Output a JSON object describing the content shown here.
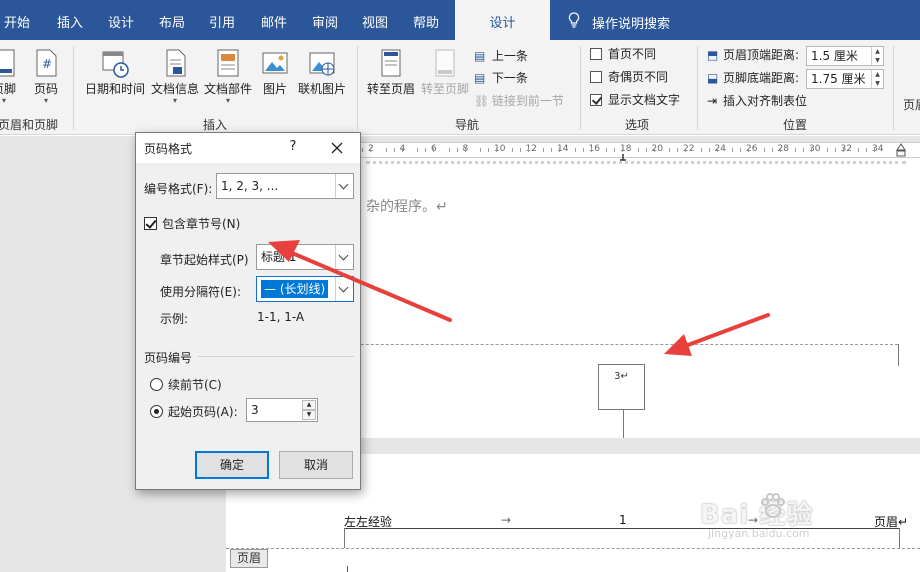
{
  "menu": {
    "tabs": [
      {
        "label": "开始"
      },
      {
        "label": "插入"
      },
      {
        "label": "设计"
      },
      {
        "label": "布局"
      },
      {
        "label": "引用"
      },
      {
        "label": "邮件"
      },
      {
        "label": "审阅"
      },
      {
        "label": "视图"
      },
      {
        "label": "帮助"
      },
      {
        "label": "设计"
      }
    ],
    "tell_me": "操作说明搜索"
  },
  "ribbon": {
    "header_footer_group": {
      "footer_label": "页脚",
      "page_number_label": "页码",
      "group_label": "页眉和页脚"
    },
    "insert_group": {
      "date_time": "日期和时间",
      "doc_info": "文档信息",
      "doc_parts": "文档部件",
      "picture": "图片",
      "online_picture": "联机图片",
      "group_label": "插入"
    },
    "navigation_group": {
      "goto_header": "转至页眉",
      "goto_footer": "转至页脚",
      "previous": "上一条",
      "next": "下一条",
      "link_previous": "链接到前一节",
      "group_label": "导航"
    },
    "options_group": {
      "different_first": "首页不同",
      "different_odd_even": "奇偶页不同",
      "show_doc_text": "显示文档文字",
      "show_doc_text_checked": true,
      "group_label": "选项"
    },
    "position_group": {
      "header_top_label": "页眉顶端距离:",
      "header_top_value": "1.5 厘米",
      "footer_bottom_label": "页脚底端距离:",
      "footer_bottom_value": "1.75 厘米",
      "insert_align_tab": "插入对齐制表位",
      "group_label": "位置"
    },
    "close_group_label": "页眉"
  },
  "ruler": {
    "labels": [
      "2",
      "4",
      "6",
      "8",
      "10",
      "12",
      "14",
      "16",
      "18",
      "20",
      "22",
      "24",
      "26",
      "28",
      "30",
      "32",
      "34"
    ]
  },
  "document": {
    "line2_text": "杂的程序。↵",
    "page_number_text": "3↵",
    "header_left": "左左经验",
    "header_tab1": "→",
    "header_center": "1",
    "header_tab2": "→",
    "header_right": "页眉↵",
    "header_tag": "页眉"
  },
  "watermark": {
    "text": "Bai 经验",
    "url": "jingyan.baidu.com"
  },
  "dialog": {
    "title": "页码格式",
    "help": "?",
    "number_format_label": "编号格式(F):",
    "number_format_value": "1, 2, 3, ...",
    "include_chapter_label": "包含章节号(N)",
    "include_chapter_checked": true,
    "chapter_style_label": "章节起始样式(P)",
    "chapter_style_value": "标题 1",
    "separator_label": "使用分隔符(E):",
    "separator_value": "— (长划线)",
    "example_label": "示例:",
    "example_value": "1-1, 1-A",
    "page_numbering_section": "页码编号",
    "continue_label": "续前节(C)",
    "continue_selected": false,
    "start_at_label": "起始页码(A):",
    "start_at_selected": true,
    "start_at_value": "3",
    "ok_label": "确定",
    "cancel_label": "取消"
  },
  "colors": {
    "accent": "#2b579a",
    "annotation_arrow": "#e8413c",
    "selection": "#0078d7"
  }
}
